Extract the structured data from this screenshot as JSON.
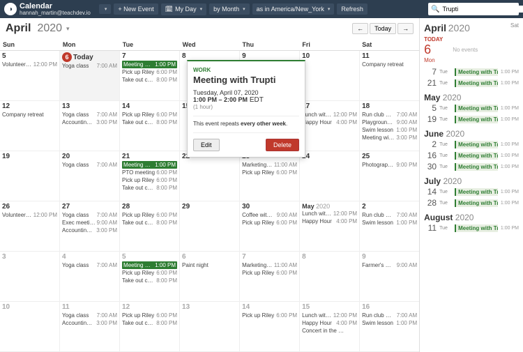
{
  "topbar": {
    "app": "Calendar",
    "user": "hannah_martin@teachdev.io",
    "new_event": "+ New Event",
    "my_day": "My Day",
    "by_month": "by Month",
    "timezone": "as in America/New_York",
    "refresh": "Refresh",
    "search_value": "Trupti"
  },
  "header": {
    "month": "April",
    "year": "2020",
    "today_btn": "Today",
    "prev": "←",
    "next": "→"
  },
  "dow": [
    "Sun",
    "Mon",
    "Tue",
    "Wed",
    "Thu",
    "Fri",
    "Sat"
  ],
  "weeks": [
    [
      {
        "num": "5",
        "events": [
          {
            "t": "Volunteering …",
            "tm": "12:00 PM"
          }
        ]
      },
      {
        "num": "6",
        "today": true,
        "today_label": "Today",
        "events": [
          {
            "t": "Yoga class",
            "tm": "7:00 AM"
          }
        ]
      },
      {
        "num": "7",
        "events": [
          {
            "t": "Meeting with Tr…",
            "tm": "1:00 PM",
            "hl": true
          },
          {
            "t": "Pick up Riley",
            "tm": "6:00 PM"
          },
          {
            "t": "Take out comp…",
            "tm": "8:00 PM"
          }
        ]
      },
      {
        "num": "8",
        "events": []
      },
      {
        "num": "9",
        "events": []
      },
      {
        "num": "10",
        "events": []
      },
      {
        "num": "11",
        "events": [
          {
            "t": "Company retreat",
            "tm": ""
          }
        ]
      }
    ],
    [
      {
        "num": "12",
        "events": [
          {
            "t": "Company retreat",
            "tm": ""
          }
        ]
      },
      {
        "num": "13",
        "events": [
          {
            "t": "Yoga class",
            "tm": "7:00 AM"
          },
          {
            "t": "Accounting call",
            "tm": "3:00 PM"
          }
        ]
      },
      {
        "num": "14",
        "events": [
          {
            "t": "Pick up Riley",
            "tm": "6:00 PM"
          },
          {
            "t": "Take out comp…",
            "tm": "8:00 PM"
          }
        ]
      },
      {
        "num": "15",
        "events": []
      },
      {
        "num": "16",
        "events": []
      },
      {
        "num": "17",
        "events": [
          {
            "t": "Lunch with M…",
            "tm": "12:00 PM"
          },
          {
            "t": "Happy Hour",
            "tm": "4:00 PM"
          }
        ]
      },
      {
        "num": "18",
        "events": [
          {
            "t": "Run club meet …",
            "tm": "7:00 AM"
          },
          {
            "t": "Playground pla…",
            "tm": "9:00 AM"
          },
          {
            "t": "Swim lesson",
            "tm": "1:00 PM"
          },
          {
            "t": "Meeting with C…",
            "tm": "3:00 PM"
          }
        ]
      }
    ],
    [
      {
        "num": "19",
        "events": []
      },
      {
        "num": "20",
        "events": [
          {
            "t": "Yoga class",
            "tm": "7:00 AM"
          }
        ]
      },
      {
        "num": "21",
        "events": [
          {
            "t": "Meeting with Tr…",
            "tm": "1:00 PM",
            "hl": true
          },
          {
            "t": "PTO meeting",
            "tm": "6:00 PM"
          },
          {
            "t": "Pick up Riley",
            "tm": "6:00 PM"
          },
          {
            "t": "Take out comp…",
            "tm": "8:00 PM"
          }
        ]
      },
      {
        "num": "22",
        "events": []
      },
      {
        "num": "23",
        "events": [
          {
            "t": "Marketing call",
            "tm": "11:00 AM"
          },
          {
            "t": "Pick up Riley",
            "tm": "6:00 PM"
          }
        ]
      },
      {
        "num": "24",
        "events": []
      },
      {
        "num": "25",
        "events": [
          {
            "t": "Photography …",
            "tm": "9:00 PM"
          }
        ]
      }
    ],
    [
      {
        "num": "26",
        "events": [
          {
            "t": "Volunteering …",
            "tm": "12:00 PM"
          }
        ]
      },
      {
        "num": "27",
        "events": [
          {
            "t": "Yoga class",
            "tm": "7:00 AM"
          },
          {
            "t": "Exec meeting",
            "tm": "9:00 AM"
          },
          {
            "t": "Accounting call",
            "tm": "3:00 PM"
          }
        ]
      },
      {
        "num": "28",
        "events": [
          {
            "t": "Pick up Riley",
            "tm": "6:00 PM"
          },
          {
            "t": "Take out comp…",
            "tm": "8:00 PM"
          }
        ]
      },
      {
        "num": "29",
        "events": []
      },
      {
        "num": "30",
        "events": [
          {
            "t": "Coffee with Ni…",
            "tm": "9:00 AM"
          },
          {
            "t": "Pick up Riley",
            "tm": "6:00 PM"
          }
        ]
      },
      {
        "monthlabel": "May",
        "year": "2020",
        "events": [
          {
            "t": "Lunch with M…",
            "tm": "12:00 PM"
          },
          {
            "t": "Happy Hour",
            "tm": "4:00 PM"
          }
        ]
      },
      {
        "num": "2",
        "events": [
          {
            "t": "Run club meet …",
            "tm": "7:00 AM"
          },
          {
            "t": "Swim lesson",
            "tm": "1:00 PM"
          }
        ]
      }
    ],
    [
      {
        "num": "3",
        "off": true,
        "events": []
      },
      {
        "num": "4",
        "off": true,
        "events": [
          {
            "t": "Yoga class",
            "tm": "7:00 AM"
          }
        ]
      },
      {
        "num": "5",
        "off": true,
        "events": [
          {
            "t": "Meeting with Tr…",
            "tm": "1:00 PM",
            "hl": true
          },
          {
            "t": "Pick up Riley",
            "tm": "6:00 PM"
          },
          {
            "t": "Take out comp…",
            "tm": "8:00 PM"
          }
        ]
      },
      {
        "num": "6",
        "off": true,
        "events": [
          {
            "t": "Paint night",
            "tm": ""
          }
        ]
      },
      {
        "num": "7",
        "off": true,
        "events": [
          {
            "t": "Marketing call",
            "tm": "11:00 AM"
          },
          {
            "t": "Pick up Riley",
            "tm": "6:00 PM"
          }
        ]
      },
      {
        "num": "8",
        "off": true,
        "events": []
      },
      {
        "num": "9",
        "off": true,
        "events": [
          {
            "t": "Farmer's market",
            "tm": "9:00 AM"
          }
        ]
      }
    ],
    [
      {
        "num": "10",
        "off": true,
        "events": []
      },
      {
        "num": "11",
        "off": true,
        "events": [
          {
            "t": "Yoga class",
            "tm": "7:00 AM"
          },
          {
            "t": "Accounting call",
            "tm": "3:00 PM"
          }
        ]
      },
      {
        "num": "12",
        "off": true,
        "events": [
          {
            "t": "Pick up Riley",
            "tm": "6:00 PM"
          },
          {
            "t": "Take out comp…",
            "tm": "8:00 PM"
          }
        ]
      },
      {
        "num": "13",
        "off": true,
        "events": []
      },
      {
        "num": "14",
        "off": true,
        "events": [
          {
            "t": "Pick up Riley",
            "tm": "6:00 PM"
          }
        ]
      },
      {
        "num": "15",
        "off": true,
        "events": [
          {
            "t": "Lunch with M…",
            "tm": "12:00 PM"
          },
          {
            "t": "Happy Hour",
            "tm": "4:00 PM"
          },
          {
            "t": "Concert in the …",
            "tm": ""
          }
        ]
      },
      {
        "num": "16",
        "off": true,
        "events": [
          {
            "t": "Run club meet …",
            "tm": "7:00 AM"
          },
          {
            "t": "Swim lesson",
            "tm": "1:00 PM"
          }
        ]
      }
    ]
  ],
  "popover": {
    "category": "WORK",
    "title": "Meeting with Trupti",
    "date": "Tuesday, April 07, 2020",
    "time": "1:00 PM – 2:00 PM",
    "tz": "EDT",
    "duration": "(1 hour)",
    "repeats_pre": "This event repeats ",
    "repeats_bold": "every other week",
    "repeats_post": ".",
    "edit": "Edit",
    "delete": "Delete"
  },
  "side": {
    "month": "April",
    "year": "2020",
    "dow_today": "Sat",
    "today_label": "TODAY",
    "today_num": "6",
    "today_dw": "Mon",
    "no_events": "No events",
    "groups": [
      {
        "month": "",
        "rows": [
          {
            "d": "7",
            "dw": "Tue",
            "title": "Meeting with Trupti",
            "tm": "1:00 PM"
          },
          {
            "d": "21",
            "dw": "Tue",
            "title": "Meeting with Trupti",
            "tm": "1:00 PM"
          }
        ]
      },
      {
        "month": "May",
        "year": "2020",
        "rows": [
          {
            "d": "5",
            "dw": "Tue",
            "title": "Meeting with Trupti",
            "tm": "1:00 PM"
          },
          {
            "d": "19",
            "dw": "Tue",
            "title": "Meeting with Trupti",
            "tm": "1:00 PM"
          }
        ]
      },
      {
        "month": "June",
        "year": "2020",
        "rows": [
          {
            "d": "2",
            "dw": "Tue",
            "title": "Meeting with Trupti",
            "tm": "1:00 PM"
          },
          {
            "d": "16",
            "dw": "Tue",
            "title": "Meeting with Trupti",
            "tm": "1:00 PM"
          },
          {
            "d": "30",
            "dw": "Tue",
            "title": "Meeting with Trupti",
            "tm": "1:00 PM"
          }
        ]
      },
      {
        "month": "July",
        "year": "2020",
        "rows": [
          {
            "d": "14",
            "dw": "Tue",
            "title": "Meeting with Trupti",
            "tm": "1:00 PM"
          },
          {
            "d": "28",
            "dw": "Tue",
            "title": "Meeting with Trupti",
            "tm": "1:00 PM"
          }
        ]
      },
      {
        "month": "August",
        "year": "2020",
        "rows": [
          {
            "d": "11",
            "dw": "Tue",
            "title": "Meeting with Trupti",
            "tm": "1:00 PM"
          }
        ]
      }
    ]
  }
}
